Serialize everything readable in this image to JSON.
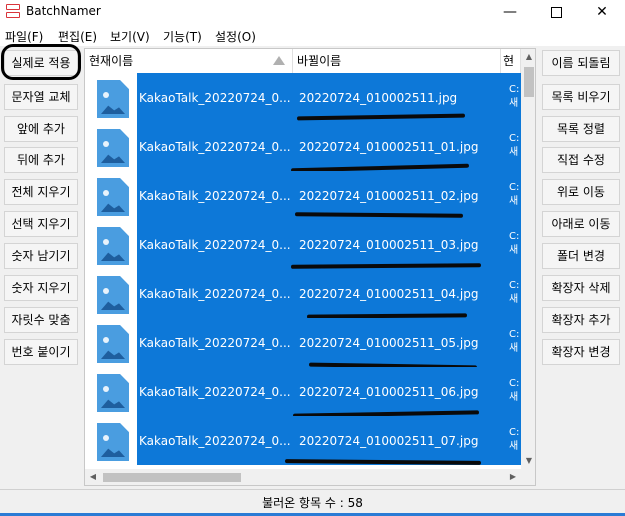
{
  "window": {
    "title": "BatchNamer",
    "minimize": "—",
    "close": "✕"
  },
  "menu": [
    "파일(F)",
    "편집(E)",
    "보기(V)",
    "기능(T)",
    "설정(O)"
  ],
  "left_buttons": [
    "실제로 적용",
    "문자열 교체",
    "앞에 추가",
    "뒤에 추가",
    "전체 지우기",
    "선택 지우기",
    "숫자 남기기",
    "숫자 지우기",
    "자릿수 맞춤",
    "번호 붙이기"
  ],
  "right_buttons": [
    "이름 되돌림",
    "목록 비우기",
    "목록 정렬",
    "직접 수정",
    "위로 이동",
    "아래로 이동",
    "폴더 변경",
    "확장자 삭제",
    "확장자 추가",
    "확장자 변경"
  ],
  "list": {
    "columns": {
      "current": "현재이름",
      "new": "바뀔이름",
      "path": "현"
    },
    "rows": [
      {
        "current": "KakaoTalk_20220724_0...",
        "new": "20220724_010002511.jpg",
        "path1": "C:",
        "path2": "새"
      },
      {
        "current": "KakaoTalk_20220724_0...",
        "new": "20220724_010002511_01.jpg",
        "path1": "C:",
        "path2": "새"
      },
      {
        "current": "KakaoTalk_20220724_0...",
        "new": "20220724_010002511_02.jpg",
        "path1": "C:",
        "path2": "새"
      },
      {
        "current": "KakaoTalk_20220724_0...",
        "new": "20220724_010002511_03.jpg",
        "path1": "C:",
        "path2": "새"
      },
      {
        "current": "KakaoTalk_20220724_0...",
        "new": "20220724_010002511_04.jpg",
        "path1": "C:",
        "path2": "새"
      },
      {
        "current": "KakaoTalk_20220724_0...",
        "new": "20220724_010002511_05.jpg",
        "path1": "C:",
        "path2": "새"
      },
      {
        "current": "KakaoTalk_20220724_0...",
        "new": "20220724_010002511_06.jpg",
        "path1": "C:",
        "path2": "새"
      },
      {
        "current": "KakaoTalk_20220724_0...",
        "new": "20220724_010002511_07.jpg",
        "path1": "C:",
        "path2": "새"
      }
    ]
  },
  "status": {
    "text": "불러온 항목 수 : 58"
  },
  "colors": {
    "selection": "#0d78d8",
    "accent": "#2a7bd5",
    "app_icon": "#d9343a"
  }
}
